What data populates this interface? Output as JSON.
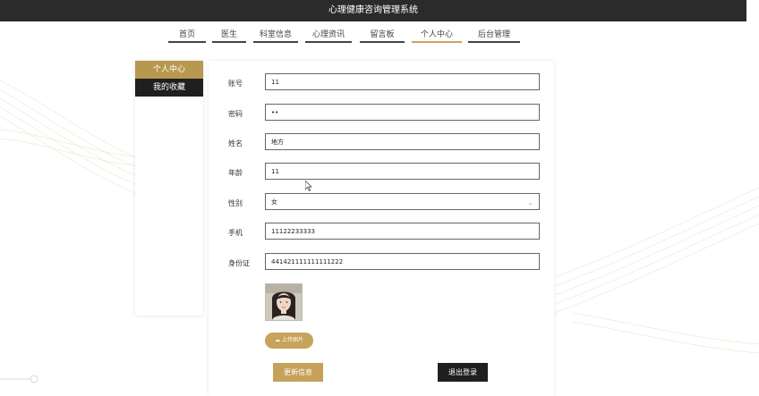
{
  "header": {
    "title": "心理健康咨询管理系统"
  },
  "nav": {
    "items": [
      {
        "label": "首页"
      },
      {
        "label": "医生"
      },
      {
        "label": "科室信息"
      },
      {
        "label": "心理资讯"
      },
      {
        "label": "留言板"
      },
      {
        "label": "个人中心",
        "active": true
      },
      {
        "label": "后台管理"
      }
    ]
  },
  "sidebar": {
    "items": [
      {
        "label": "个人中心"
      },
      {
        "label": "我的收藏"
      }
    ]
  },
  "form": {
    "account_label": "账号",
    "account_value": "11",
    "password_label": "密码",
    "password_value": "••",
    "name_label": "姓名",
    "name_value": "地方",
    "age_label": "年龄",
    "age_value": "11",
    "gender_label": "性别",
    "gender_value": "女",
    "phone_label": "手机",
    "phone_value": "11122233333",
    "id_label": "身份证",
    "id_value": "441421111111111222",
    "upload_label": "上传图片",
    "update_label": "更新信息",
    "logout_label": "退出登录"
  },
  "colors": {
    "topbar": "#2b2b2b",
    "gold": "#c8a35b",
    "dark": "#1f1f1f"
  }
}
